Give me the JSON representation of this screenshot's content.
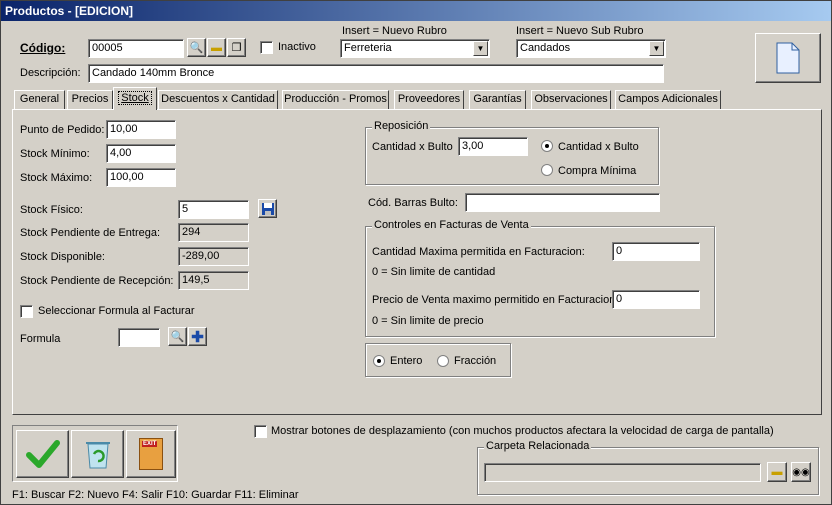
{
  "window": {
    "title": "Productos - [EDICION]"
  },
  "header": {
    "codigo_label": "Código:",
    "codigo_value": "00005",
    "inactivo_label": "Inactivo",
    "rubro_caption": "Insert = Nuevo Rubro",
    "rubro_value": "Ferreteria",
    "subrubro_caption": "Insert = Nuevo Sub Rubro",
    "subrubro_value": "Candados",
    "descripcion_label": "Descripción:",
    "descripcion_value": "Candado 140mm Bronce"
  },
  "tabs": [
    {
      "label": "General"
    },
    {
      "label": "Precios"
    },
    {
      "label": "Stock",
      "active": true
    },
    {
      "label": "Descuentos x Cantidad"
    },
    {
      "label": "Producción - Promos"
    },
    {
      "label": "Proveedores"
    },
    {
      "label": "Garantías"
    },
    {
      "label": "Observaciones"
    },
    {
      "label": "Campos Adicionales"
    }
  ],
  "stock": {
    "punto_pedido_label": "Punto de Pedido:",
    "punto_pedido_value": "10,00",
    "stock_min_label": "Stock Mínimo:",
    "stock_min_value": "4,00",
    "stock_max_label": "Stock Máximo:",
    "stock_max_value": "100,00",
    "fisico_label": "Stock Físico:",
    "fisico_value": "5",
    "pend_entrega_label": "Stock Pendiente de Entrega:",
    "pend_entrega_value": "294",
    "disponible_label": "Stock Disponible:",
    "disponible_value": "-289,00",
    "pend_recepcion_label": "Stock Pendiente de Recepción:",
    "pend_recepcion_value": "149,5",
    "formula_check_label": "Seleccionar Formula al Facturar",
    "formula_label": "Formula",
    "formula_value": ""
  },
  "reposicion": {
    "caption": "Reposición",
    "cant_bulto_label": "Cantidad x Bulto",
    "cant_bulto_value": "3,00",
    "radio_cant_bulto": "Cantidad x Bulto",
    "radio_compra_minima": "Compra Mínima",
    "selected": "cant_bulto"
  },
  "barras": {
    "label": "Cód. Barras Bulto:",
    "value": ""
  },
  "controles": {
    "caption": "Controles en Facturas de Venta",
    "cant_max_label": "Cantidad Maxima permitida en Facturacion:",
    "cant_max_value": "0",
    "cant_note": "0 = Sin limite de cantidad",
    "precio_max_label": "Precio de Venta maximo permitido en Facturacion:",
    "precio_max_value": "0",
    "precio_note": "0 = Sin limite de precio"
  },
  "unidad": {
    "entero": "Entero",
    "fraccion": "Fracción",
    "selected": "entero"
  },
  "footer": {
    "mostrar_label": "Mostrar botones de desplazamiento  (con muchos productos afectara la velocidad de carga de pantalla)",
    "carpeta_caption": "Carpeta Relacionada",
    "carpeta_value": "",
    "shortcuts": "F1: Buscar  F2: Nuevo  F4: Salir  F10: Guardar  F11: Eliminar",
    "exit_text": "EXIT"
  }
}
